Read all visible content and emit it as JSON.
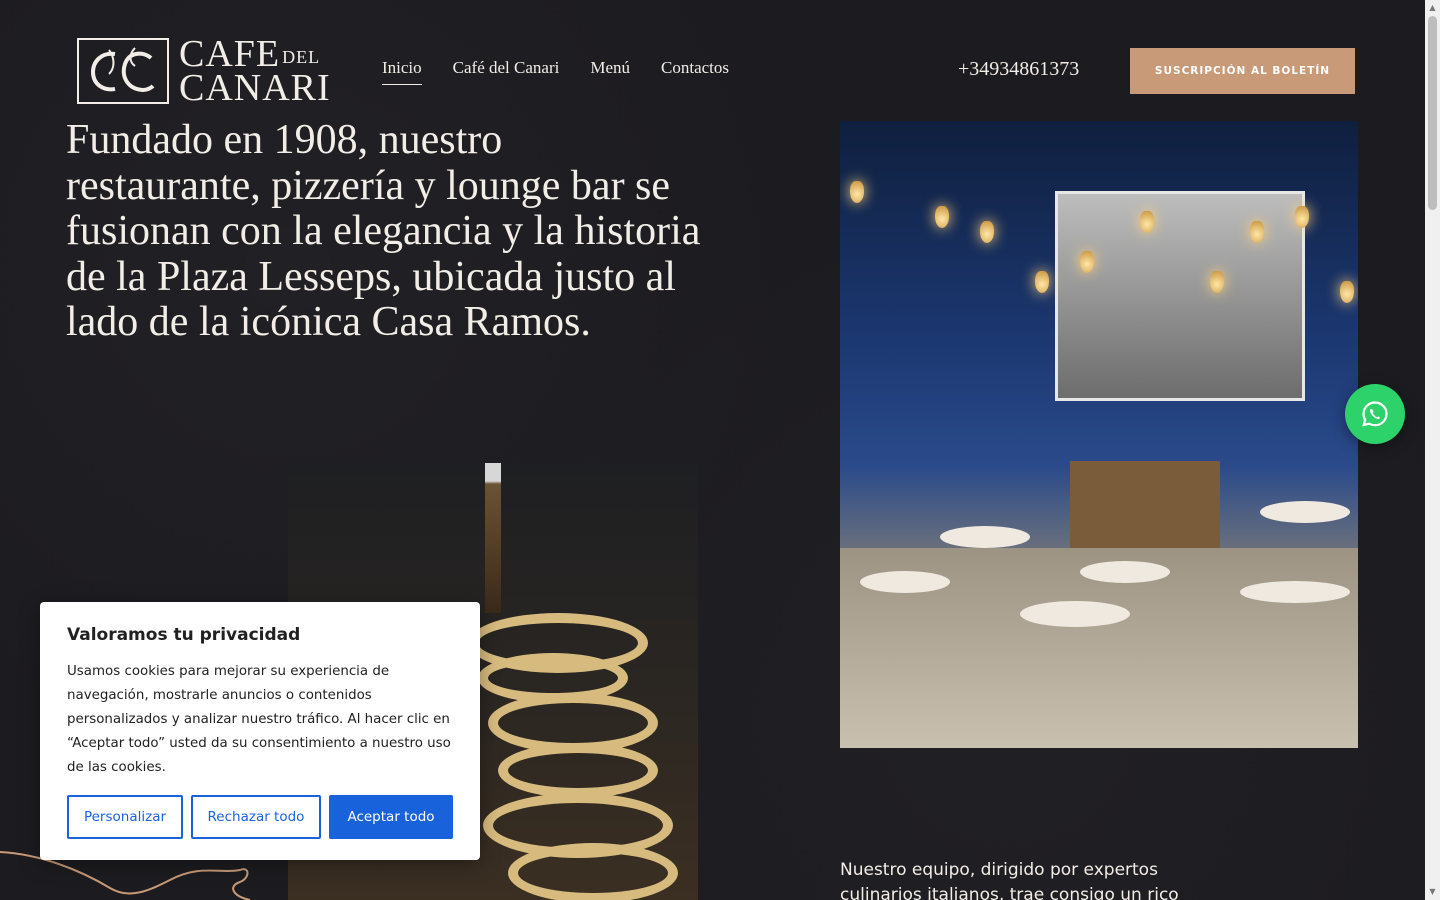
{
  "header": {
    "logo": {
      "line1": "CAFE",
      "line1_small": "DEL",
      "line2": "CANARI"
    },
    "nav": [
      {
        "label": "Inicio",
        "active": true
      },
      {
        "label": "Café del Canari",
        "active": false
      },
      {
        "label": "Menú",
        "active": false
      },
      {
        "label": "Contactos",
        "active": false
      }
    ],
    "phone": "+34934861373",
    "newsletter_label": "SUSCRIPCIÓN AL BOLETÍN"
  },
  "hero": {
    "title": "Fundado en 1908, nuestro restaurante, pizzería y lounge bar se fusionan con la elegancia y la historia de la Plaza Lesseps, ubicada justo al lado de la icónica Casa Ramos."
  },
  "team": {
    "text": "Nuestro equipo, dirigido por expertos culinarios italianos, trae consigo un rico legado de sabores"
  },
  "cookie": {
    "title": "Valoramos tu privacidad",
    "body": "Usamos cookies para mejorar su experiencia de navegación, mostrarle anuncios o contenidos personalizados y analizar nuestro tráfico. Al hacer clic en “Aceptar todo” usted da su consentimiento a nuestro uso de las cookies.",
    "customize_label": "Personalizar",
    "reject_label": "Rechazar todo",
    "accept_label": "Aceptar todo"
  },
  "colors": {
    "background": "#1c1b1f",
    "accent": "#c89a77",
    "whatsapp": "#2dd36a",
    "cookie_blue": "#1863dc"
  },
  "icons": {
    "whatsapp": "whatsapp-icon",
    "logo_mark": "cc-monogram-icon"
  }
}
